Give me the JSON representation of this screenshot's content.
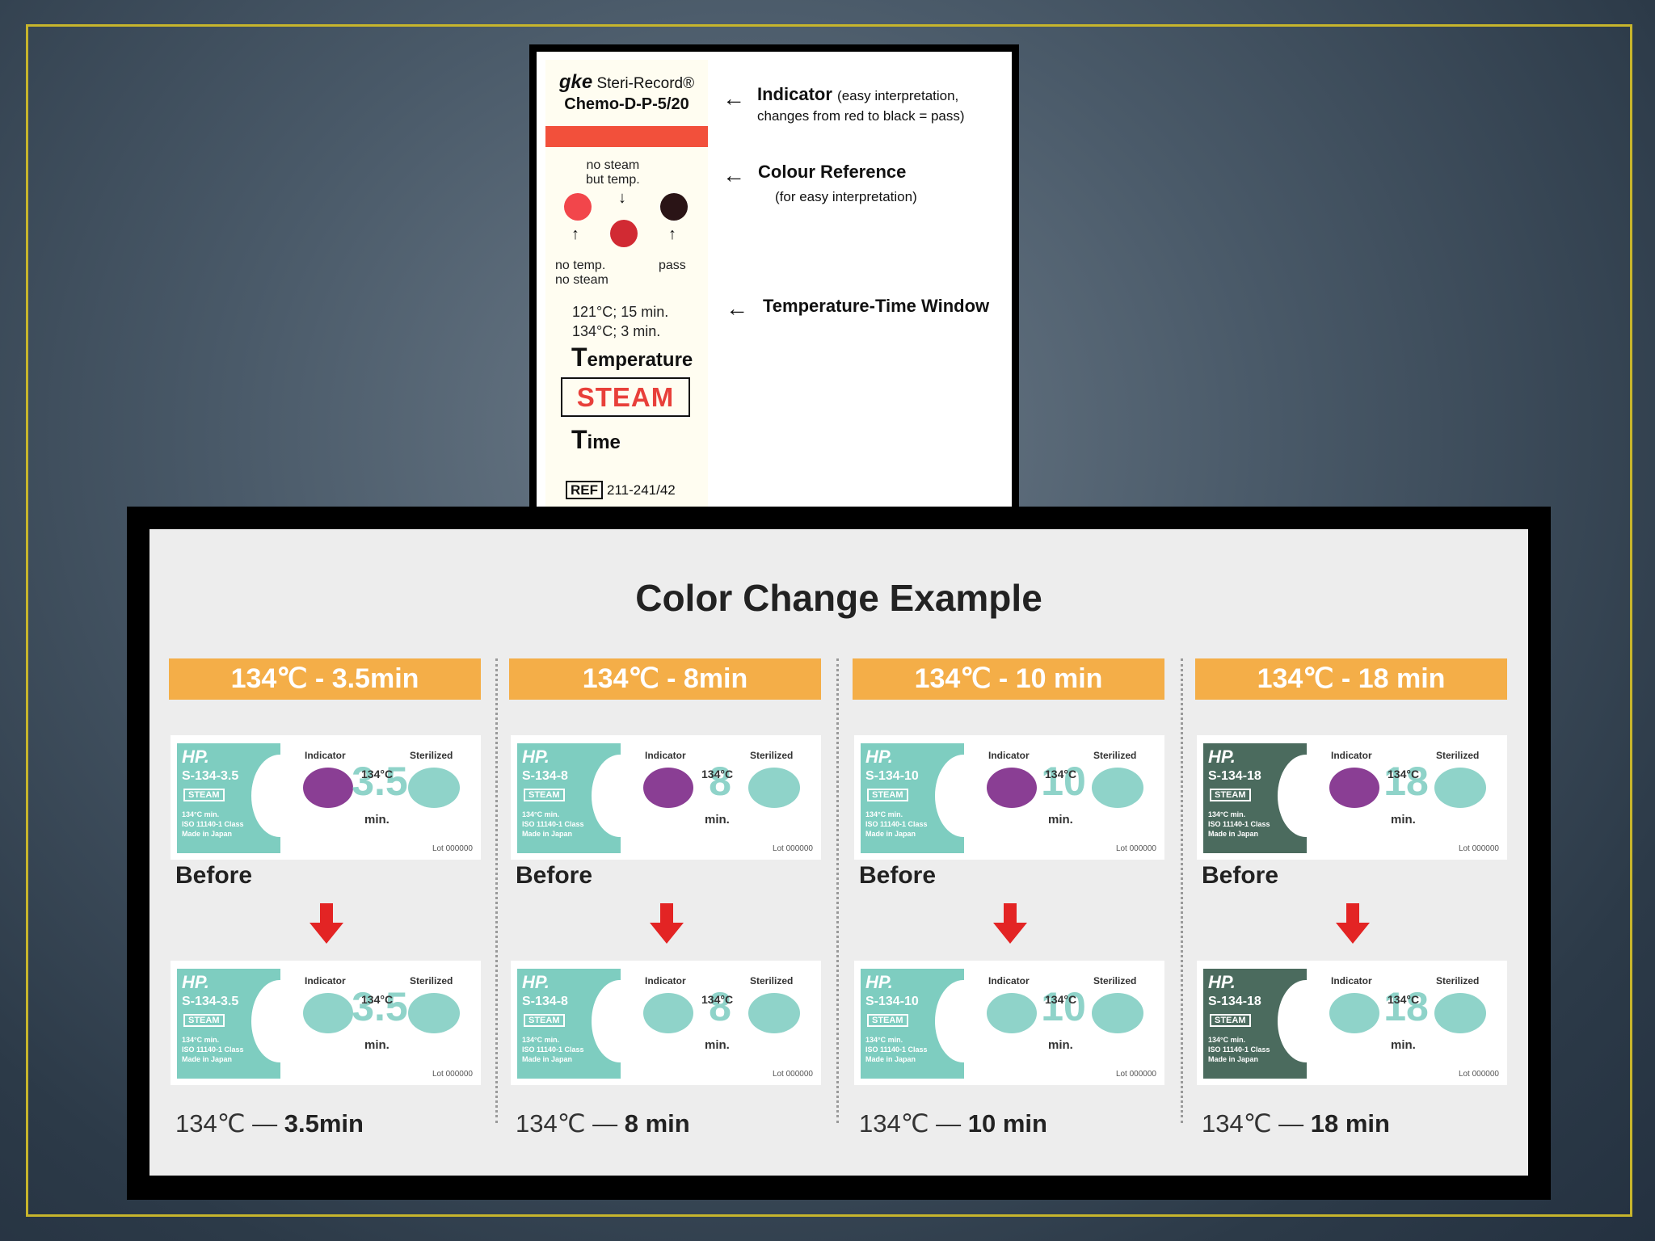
{
  "top_card": {
    "brand_prefix": "gke",
    "brand_name": "Steri-Record®",
    "model": "Chemo-D-P-5/20",
    "ref_box": "REF",
    "ref_number": "211-241/42",
    "no_steam_but_temp": "no steam\nbut temp.",
    "no_temp_no_steam": "no temp.\nno steam",
    "pass": "pass",
    "tt_line1": "121°C;   15 min.",
    "tt_line2": "134°C;    3 min.",
    "temperature_cap": "T",
    "temperature_rest": "emperature",
    "steam": "STEAM",
    "time_cap": "T",
    "time_rest": "ime",
    "indicator_title": "Indicator",
    "indicator_note1": "(easy interpretation,",
    "indicator_note2": "changes from red to black = pass)",
    "colour_ref_title": "Colour Reference",
    "colour_ref_note": "(for easy interpretation)",
    "tt_window_title": "Temperature-Time Window",
    "arrow": "←",
    "down_arrow": "↓",
    "up_arrow": "↑",
    "colors": {
      "red_light": "#f2464b",
      "red_dark": "#d12a33",
      "black": "#2a1416",
      "orange_bar": "#f2503b"
    }
  },
  "panel": {
    "title": "Color Change Example",
    "label_fine_text": "134°C  min.\nISO 11140-1 Class\nMade in Japan",
    "indicator_label": "Indicator",
    "sterilized_label": "Sterilized",
    "temp_small": "134°C",
    "min_label": "min.",
    "lot_label": "Lot 000000",
    "hp_label": "HP.",
    "steam_tag": "STEAM",
    "before_label": "Before",
    "columns": [
      {
        "header": "134℃ - 3.5min",
        "code": "S-134-3.5",
        "big": "3.5",
        "after_prefix": "134℃ — ",
        "after_value": "3.5min",
        "label_color": "#7ecdc0"
      },
      {
        "header": "134℃ - 8min",
        "code": "S-134-8",
        "big": "8",
        "after_prefix": "134℃ — ",
        "after_value": "8 min",
        "label_color": "#7ecdc0"
      },
      {
        "header": "134℃ - 10 min",
        "code": "S-134-10",
        "big": "10",
        "after_prefix": "134℃ — ",
        "after_value": "10 min",
        "label_color": "#7ecdc0"
      },
      {
        "header": "134℃ - 18 min",
        "code": "S-134-18",
        "big": "18",
        "after_prefix": "134℃ — ",
        "after_value": "18 min",
        "label_color": "#4b6b5e"
      }
    ],
    "colors": {
      "header_orange": "#f4ae48",
      "indicator_before": "#8a3e94",
      "indicator_after": "#8fd3c9",
      "arrow_red": "#e32424"
    }
  }
}
